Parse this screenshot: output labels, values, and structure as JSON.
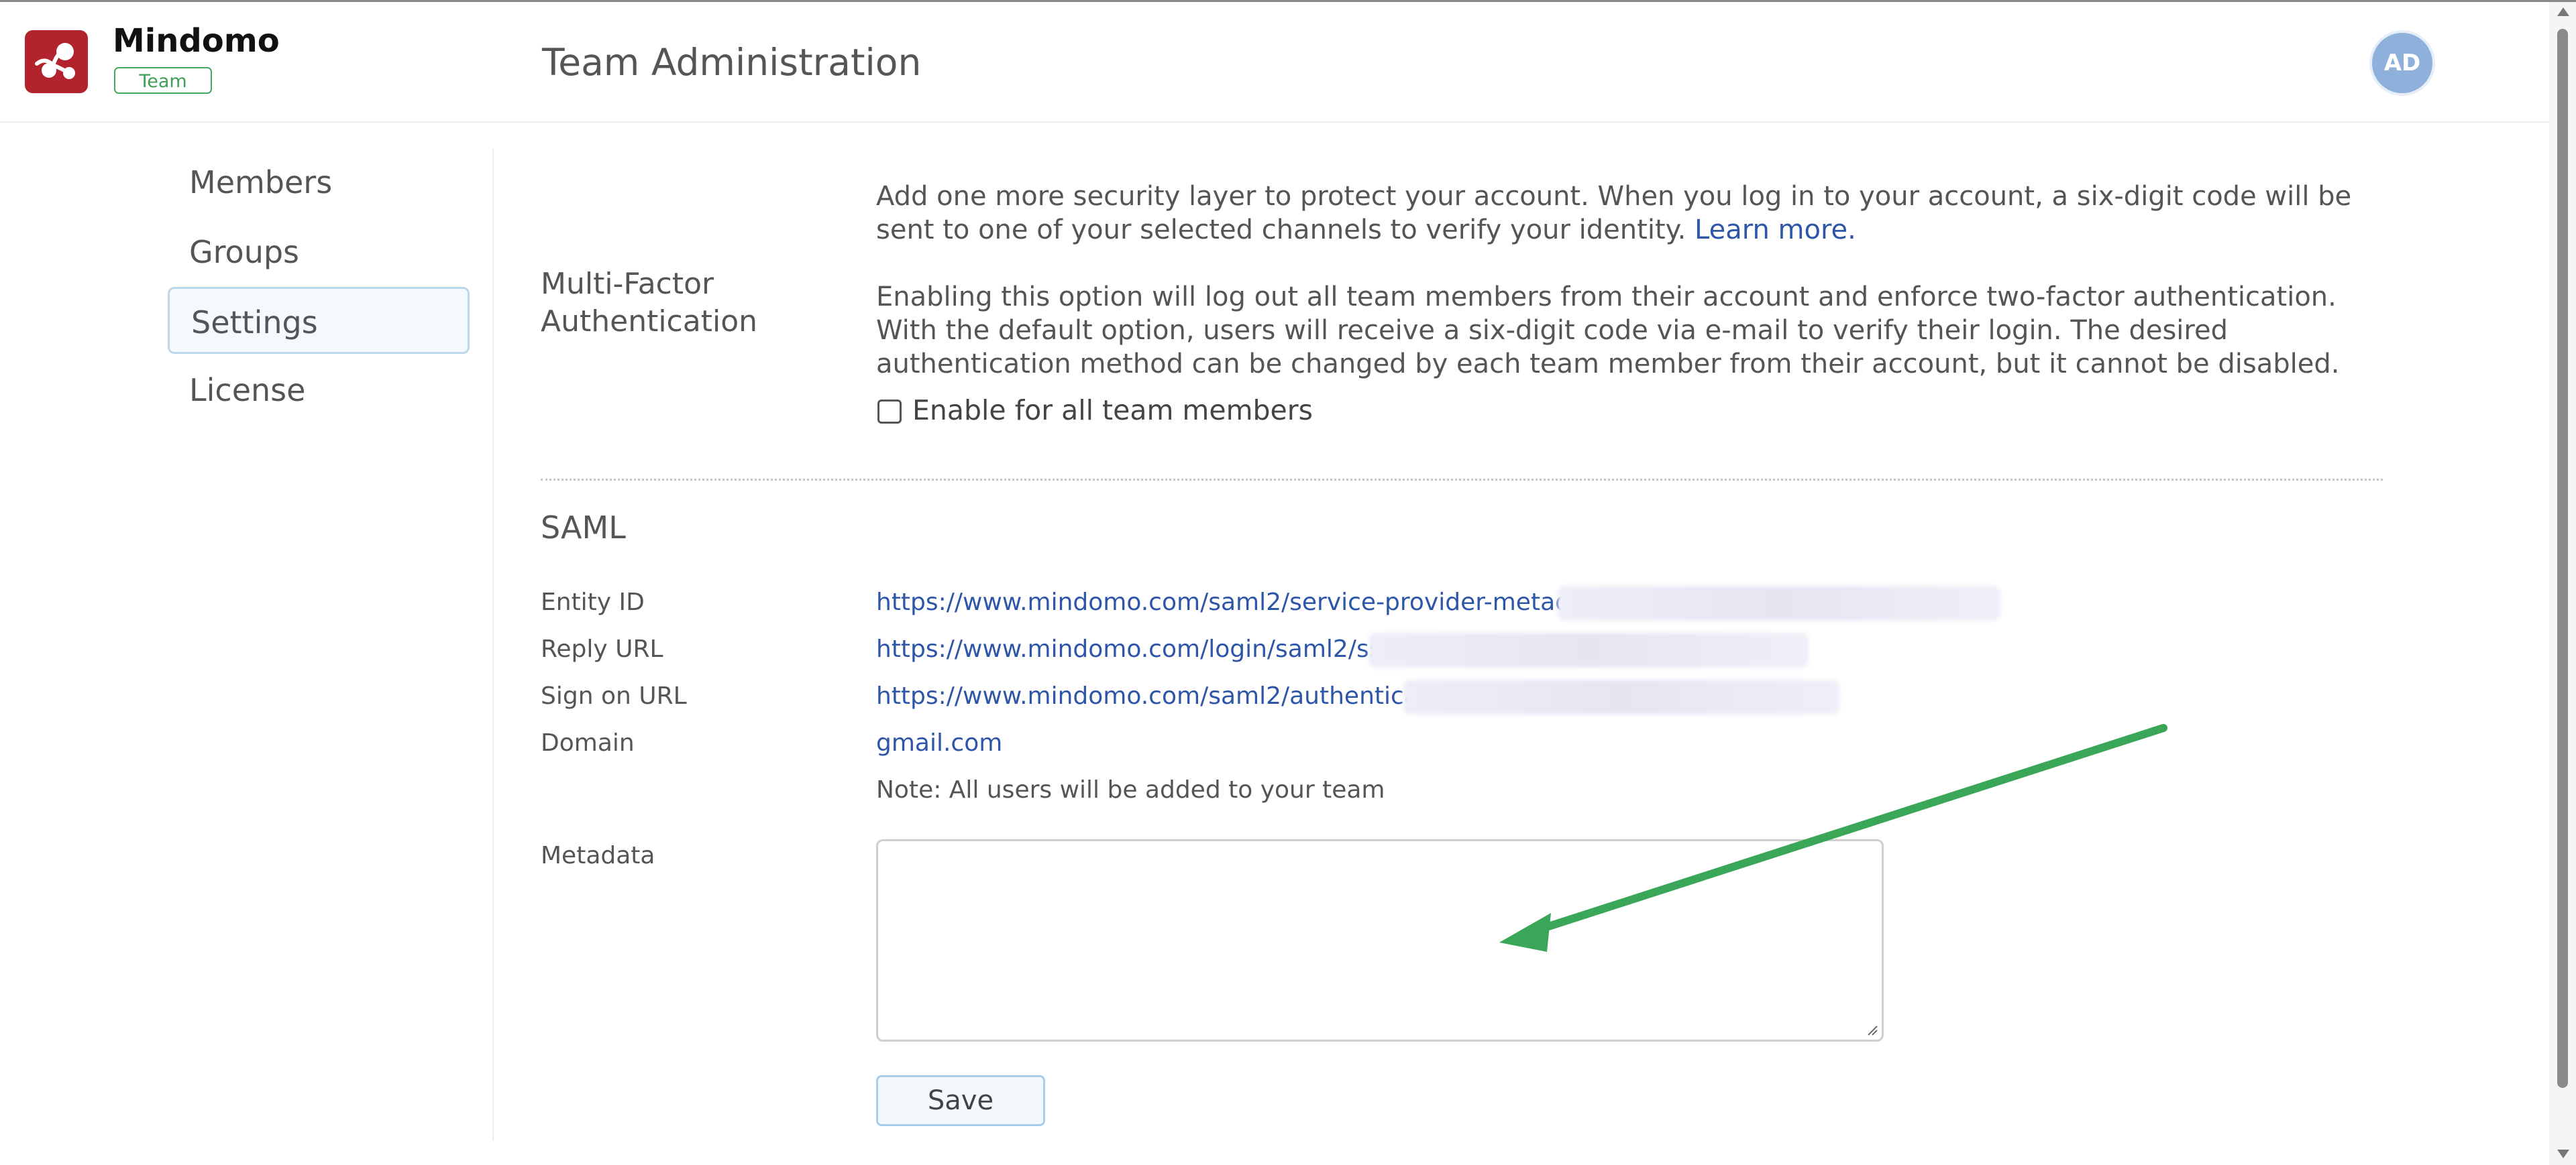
{
  "app": {
    "name": "Mindomo",
    "badge": "Team"
  },
  "header": {
    "title": "Team Administration",
    "avatar_initials": "AD"
  },
  "sidebar": {
    "items": [
      {
        "label": "Members",
        "active": false
      },
      {
        "label": "Groups",
        "active": false
      },
      {
        "label": "Settings",
        "active": true
      },
      {
        "label": "License",
        "active": false
      }
    ]
  },
  "mfa": {
    "label_line1": "Multi-Factor",
    "label_line2": "Authentication",
    "description": "Add one more security layer to protect your account. When you log in to your account, a six-digit code will be sent to one of your selected channels to verify your identity.",
    "learn_more": "Learn more.",
    "warning": "Enabling this option will log out all team members from their account and enforce two-factor authentication. With the default option, users will receive a six-digit code via e-mail to verify their login. The desired authentication method can be changed by each team member from their account, but it cannot be disabled.",
    "checkbox_label": "Enable for all team members",
    "checked": false
  },
  "saml": {
    "title": "SAML",
    "entity_id_label": "Entity ID",
    "entity_id_value": "https://www.mindomo.com/saml2/service-provider-metadata/",
    "reply_url_label": "Reply URL",
    "reply_url_value": "https://www.mindomo.com/login/saml2/sso/",
    "sign_on_url_label": "Sign on URL",
    "sign_on_url_value": "https://www.mindomo.com/saml2/authenticate/",
    "domain_label": "Domain",
    "domain_value": "gmail.com",
    "note": "Note: All users will be added to your team",
    "metadata_label": "Metadata",
    "metadata_value": "",
    "save_label": "Save"
  },
  "colors": {
    "brand": "#b3232e",
    "link": "#2e56a8",
    "badge": "#48a660",
    "annotation_arrow": "#3aa657"
  },
  "icons": {
    "logo": "mindomo-logo-icon",
    "resize": "resize-grip-icon",
    "annotation": "green-arrow-annotation"
  }
}
